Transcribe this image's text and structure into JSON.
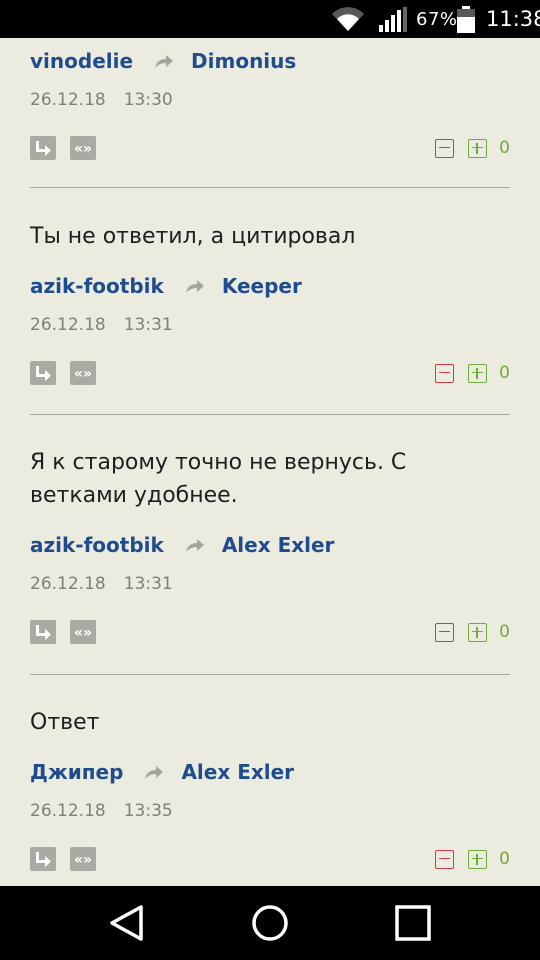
{
  "status_bar": {
    "battery": "67%",
    "time": "11:38"
  },
  "comments": [
    {
      "text": "",
      "author": "vinodelie",
      "reply_to": "Dimonius",
      "date": "26.12.18",
      "time": "13:30",
      "votes": "0"
    },
    {
      "text": "Ты не ответил, а цитировал",
      "author": "azik-footbik",
      "reply_to": "Keeper",
      "date": "26.12.18",
      "time": "13:31",
      "votes": "0"
    },
    {
      "text": "Я к старому точно не вернусь. С ветками удобнее.",
      "author": "azik-footbik",
      "reply_to": "Alex Exler",
      "date": "26.12.18",
      "time": "13:31",
      "votes": "0"
    },
    {
      "text": "Ответ",
      "author": "Джипер",
      "reply_to": "Alex Exler",
      "date": "26.12.18",
      "time": "13:35",
      "votes": "0"
    }
  ],
  "icons": {
    "reply": "reply-icon",
    "quote": "quote-icon",
    "reply_arrow": "reply-arrow-icon",
    "vote_down": "minus-icon",
    "vote_up": "plus-icon"
  },
  "colors": {
    "background": "#ecebe0",
    "author_link": "#1f4c8f",
    "vote_down": "#d23b48",
    "vote_up": "#6fab3a"
  }
}
